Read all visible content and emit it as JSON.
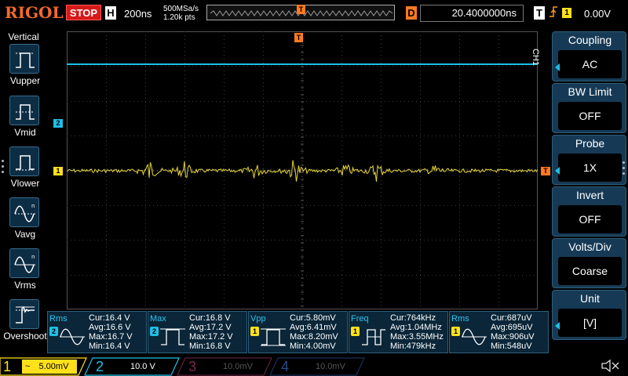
{
  "topbar": {
    "logo": "RIGOL",
    "run_state": "STOP",
    "h_badge": "H",
    "timebase": "200ns",
    "sample_rate": "500MSa/s",
    "memory_depth": "1.20k pts",
    "delay_badge": "D",
    "delay_value": "20.4000000ns",
    "trigger_badge": "T",
    "trigger_source": "1",
    "trigger_level": "0.00V"
  },
  "left_panel": {
    "title": "Vertical",
    "items": [
      {
        "label": "Vupper",
        "icon": "vupper-icon"
      },
      {
        "label": "Vmid",
        "icon": "vmid-icon"
      },
      {
        "label": "Vlower",
        "icon": "vlower-icon"
      },
      {
        "label": "Vavg",
        "icon": "vavg-icon"
      },
      {
        "label": "Vrms",
        "icon": "vrms-icon"
      },
      {
        "label": "Overshoot",
        "icon": "overshoot-icon"
      }
    ]
  },
  "screen": {
    "ch1_marker": "1",
    "ch2_marker": "2",
    "trigger_level_marker": "T",
    "trigger_pos_marker": "T",
    "channel_side_label": "CH1",
    "colors": {
      "ch1": "#e8d63a",
      "ch2": "#1cc0e8",
      "trigger": "#ff7a21",
      "grid": "#3a3a3a"
    }
  },
  "right_panel": {
    "items": [
      {
        "title": "Coupling",
        "value": "AC",
        "arrow": true
      },
      {
        "title": "BW Limit",
        "value": "OFF",
        "arrow": false
      },
      {
        "title": "Probe",
        "value": "1X",
        "arrow": true
      },
      {
        "title": "Invert",
        "value": "OFF",
        "arrow": false
      },
      {
        "title": "Volts/Div",
        "value": "Coarse",
        "arrow": false
      },
      {
        "title": "Unit",
        "value": "[V]",
        "arrow": true
      }
    ]
  },
  "measurements": [
    {
      "name": "Rms",
      "src": "2",
      "cur": "Cur:16.4 V",
      "avg": "Avg:16.6 V",
      "max": "Max:16.7 V",
      "min": "Min:16.4 V",
      "icon": "rms-icon"
    },
    {
      "name": "Max",
      "src": "2",
      "cur": "Cur:16.8 V",
      "avg": "Avg:17.2 V",
      "max": "Max:17.2 V",
      "min": "Min:16.8 V",
      "icon": "max-icon"
    },
    {
      "name": "Vpp",
      "src": "1",
      "cur": "Cur:5.80mV",
      "avg": "Avg:6.41mV",
      "max": "Max:8.20mV",
      "min": "Min:4.00mV",
      "icon": "vpp-icon"
    },
    {
      "name": "Freq",
      "src": "1",
      "cur": "Cur:764kHz",
      "avg": "Avg:1.04MHz",
      "max": "Max:3.55MHz",
      "min": "Min:479kHz",
      "icon": "freq-icon"
    },
    {
      "name": "Rms",
      "src": "1",
      "cur": "Cur:687uV",
      "avg": "Avg:695uV",
      "max": "Max:906uV",
      "min": "Min:548uV",
      "icon": "rms-icon"
    }
  ],
  "bottombar": {
    "channels": [
      {
        "num": "1",
        "coupling": "~",
        "scale": "5.00mV"
      },
      {
        "num": "2",
        "coupling": "",
        "scale": "10.0 V"
      },
      {
        "num": "3",
        "coupling": "",
        "scale": "10.0mV"
      },
      {
        "num": "4",
        "coupling": "",
        "scale": "10.0mV"
      }
    ]
  }
}
